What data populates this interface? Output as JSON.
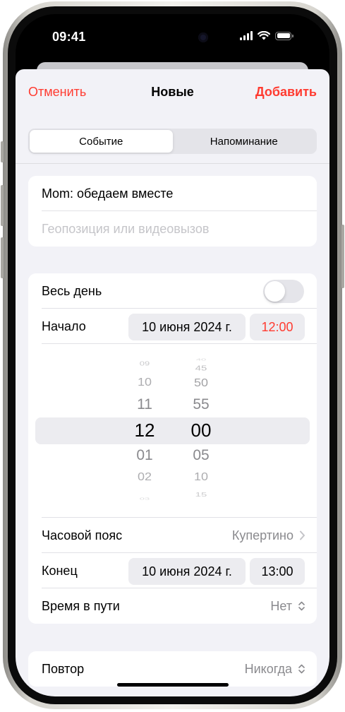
{
  "status_bar": {
    "time": "09:41"
  },
  "nav": {
    "cancel_label": "Отменить",
    "title": "Новые",
    "add_label": "Добавить"
  },
  "segmented": {
    "items": [
      "Событие",
      "Напоминание"
    ],
    "selected": 0
  },
  "title_group": {
    "title_value": "Mom: обедаем вместе",
    "location_placeholder": "Геопозиция или видеовызов"
  },
  "schedule": {
    "all_day_label": "Весь день",
    "all_day_on": false,
    "start_label": "Начало",
    "start_date": "10 июня 2024 г.",
    "start_time": "12:00",
    "picker": {
      "hours": [
        "09",
        "10",
        "11",
        "12",
        "01",
        "02",
        "03"
      ],
      "minutes": [
        "40",
        "45",
        "50",
        "55",
        "00",
        "05",
        "10",
        "15"
      ],
      "selected_hour": "12",
      "selected_minute": "00"
    },
    "timezone_label": "Часовой пояс",
    "timezone_value": "Купертино",
    "end_label": "Конец",
    "end_date": "10 июня 2024 г.",
    "end_time": "13:00",
    "travel_label": "Время в пути",
    "travel_value": "Нет"
  },
  "repeat_group": {
    "repeat_label": "Повтор",
    "repeat_value": "Никогда"
  },
  "colors": {
    "accent": "#ff3b30",
    "background": "#f2f2f7",
    "secondary_text": "#8a8a8e",
    "placeholder": "#c5c5c9"
  }
}
